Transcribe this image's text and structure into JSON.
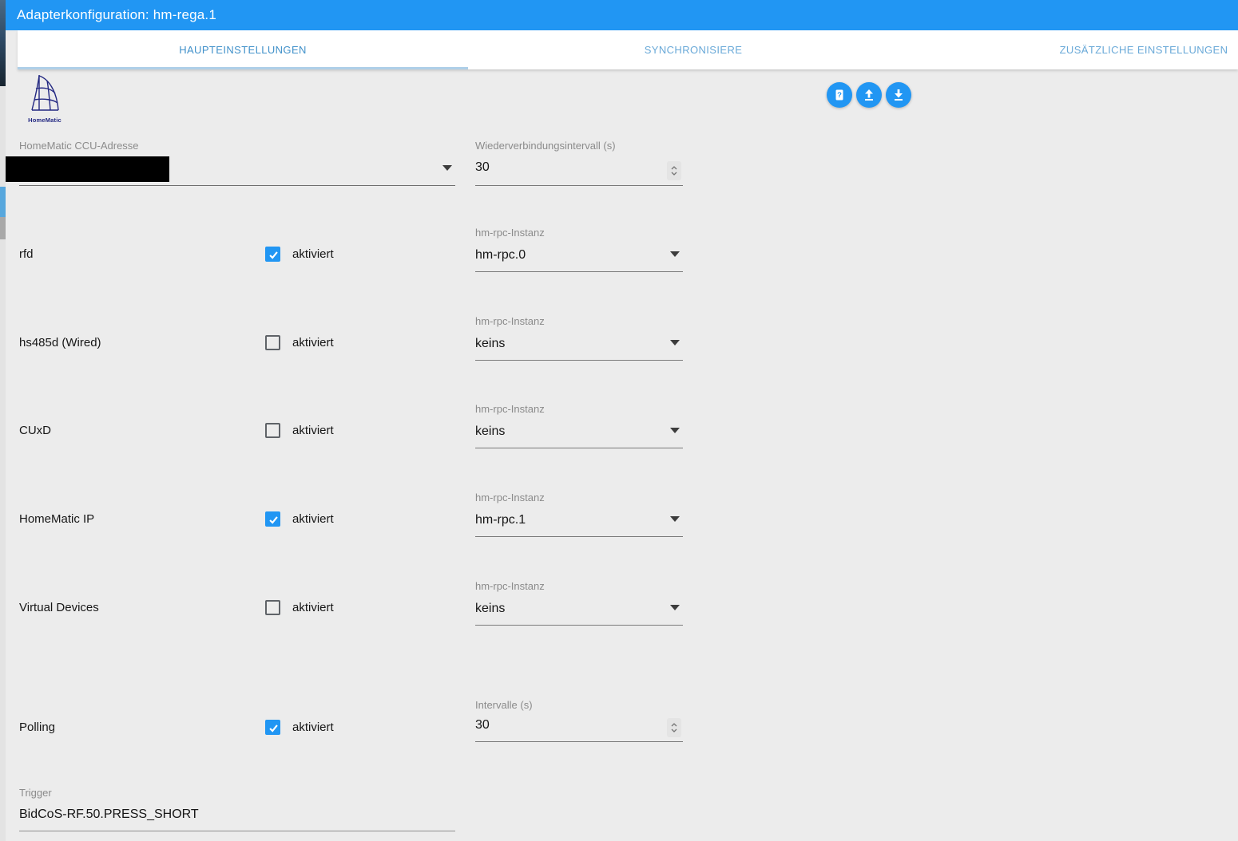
{
  "dialog": {
    "title": "Adapterkonfiguration: hm-rega.1"
  },
  "tabs": [
    {
      "label": "HAUPTEINSTELLUNGEN",
      "active": true
    },
    {
      "label": "SYNCHRONISIERE",
      "active": false
    },
    {
      "label": "ZUSÄTZLICHE EINSTELLUNGEN",
      "active": false
    }
  ],
  "toolbar": {
    "help": {
      "icon": "question-doc-icon",
      "glyph": "?"
    },
    "upload": {
      "icon": "upload-icon"
    },
    "download": {
      "icon": "download-icon"
    }
  },
  "logo": {
    "caption": "HomeMatic"
  },
  "form": {
    "ccu_address": {
      "label": "HomeMatic CCU-Adresse",
      "value": "",
      "redacted": true
    },
    "reconnect_interval": {
      "label": "Wiederverbindungsintervall (s)",
      "value": "30"
    },
    "daemons": [
      {
        "name": "rfd",
        "checkbox_label": "aktiviert",
        "enabled": true,
        "instance_label": "hm-rpc-Instanz",
        "instance": "hm-rpc.0"
      },
      {
        "name": "hs485d (Wired)",
        "checkbox_label": "aktiviert",
        "enabled": false,
        "instance_label": "hm-rpc-Instanz",
        "instance": "keins"
      },
      {
        "name": "CUxD",
        "checkbox_label": "aktiviert",
        "enabled": false,
        "instance_label": "hm-rpc-Instanz",
        "instance": "keins"
      },
      {
        "name": "HomeMatic IP",
        "checkbox_label": "aktiviert",
        "enabled": true,
        "instance_label": "hm-rpc-Instanz",
        "instance": "hm-rpc.1"
      },
      {
        "name": "Virtual Devices",
        "checkbox_label": "aktiviert",
        "enabled": false,
        "instance_label": "hm-rpc-Instanz",
        "instance": "keins"
      }
    ],
    "polling": {
      "name": "Polling",
      "checkbox_label": "aktiviert",
      "enabled": true,
      "interval_label": "Intervalle (s)",
      "interval_value": "30"
    },
    "trigger": {
      "label": "Trigger",
      "value": "BidCoS-RF.50.PRESS_SHORT"
    }
  },
  "colors": {
    "accent": "#2196f3",
    "titlebar": "#2196f3",
    "tab_active": "#4191ca",
    "tab_inactive": "#69a9d8",
    "tab_indicator": "#aecfe8",
    "content_bg": "#ececec",
    "label_gray": "#8b8b8b",
    "value_dark": "#161616",
    "logo_navy": "#232882"
  }
}
